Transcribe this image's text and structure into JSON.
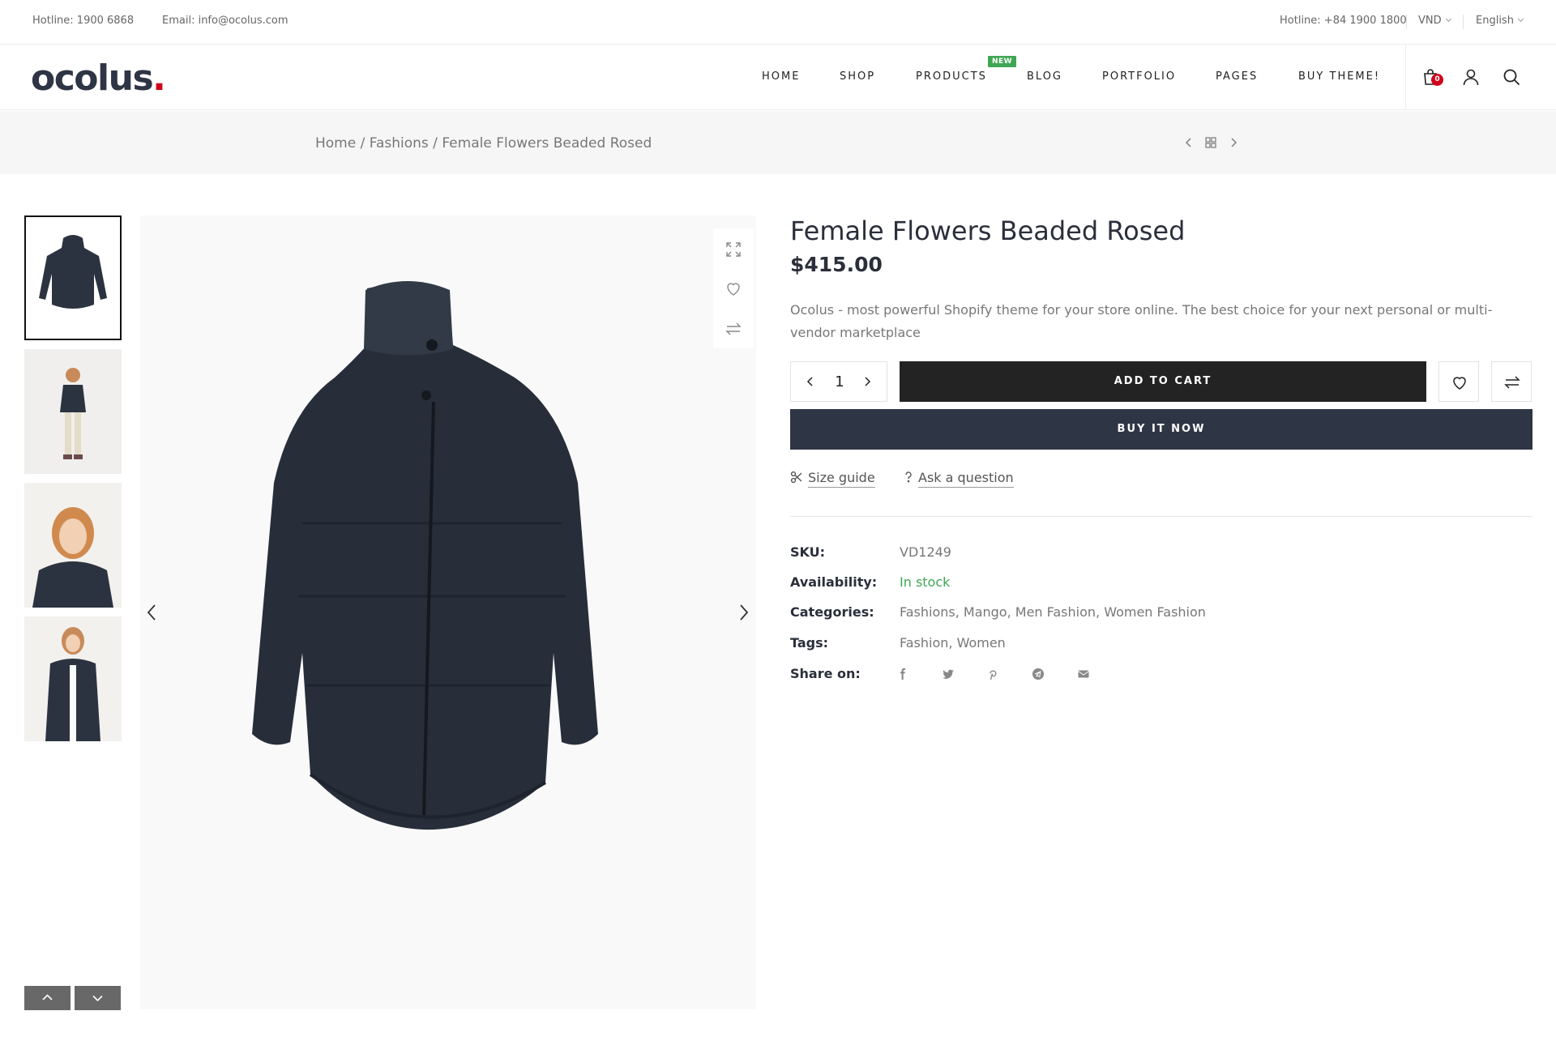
{
  "topbar": {
    "hotline_left": "Hotline: 1900 6868",
    "email": "Email: info@ocolus.com",
    "hotline_right": "Hotline: +84 1900 1800",
    "currency": "VND",
    "language": "English"
  },
  "header": {
    "logo_text": "ocolus",
    "logo_dot": ".",
    "nav": [
      "HOME",
      "SHOP",
      "PRODUCTS",
      "BLOG",
      "PORTFOLIO",
      "PAGES",
      "BUY THEME!"
    ],
    "new_badge": "NEW",
    "cart_count": "0"
  },
  "breadcrumb": {
    "home": "Home",
    "sep1": " / ",
    "category": "Fashions",
    "sep2": " / ",
    "current": "Female Flowers Beaded Rosed"
  },
  "product": {
    "title": "Female Flowers Beaded Rosed",
    "price": "$415.00",
    "description": "Ocolus - most powerful Shopify theme for your store online. The best choice for your next personal or multi-vendor marketplace",
    "quantity": "1",
    "add_to_cart": "ADD TO CART",
    "buy_now": "BUY IT NOW",
    "size_guide": "Size guide",
    "ask_question": "Ask a question",
    "meta": {
      "sku_label": "SKU:",
      "sku": "VD1249",
      "availability_label": "Availability:",
      "availability": "In stock",
      "categories_label": "Categories:",
      "categories": "Fashions, Mango, Men Fashion, Women Fashion",
      "tags_label": "Tags:",
      "tags": "Fashion, Women",
      "share_label": "Share on:"
    }
  },
  "colors": {
    "accent_red": "#d0021b",
    "new_green": "#3fa654",
    "dark_navy": "#2e3545",
    "button_dark": "#232323"
  },
  "icons": {
    "share": [
      "facebook-icon",
      "twitter-icon",
      "pinterest-icon",
      "telegram-icon",
      "email-icon"
    ],
    "header": [
      "cart-icon",
      "user-icon",
      "search-icon"
    ]
  }
}
